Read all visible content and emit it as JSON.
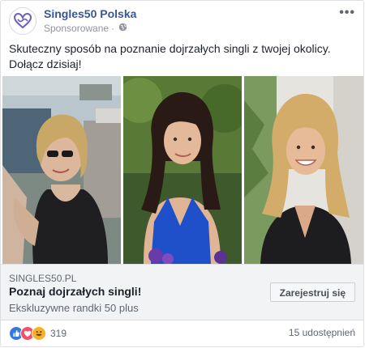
{
  "post": {
    "page_name": "Singles50 Polska",
    "sponsored_label": "Sponsorowane",
    "separator": "·",
    "more_label": "•••",
    "text": "Skuteczny sposób na poznanie dojrzałych singli z twojej okolicy. Dołącz dzisiaj!"
  },
  "link": {
    "domain": "SINGLES50.PL",
    "headline": "Poznaj dojrzałych singli!",
    "description": "Ekskluzywne randki 50 plus",
    "cta_label": "Zarejestruj się"
  },
  "engagement": {
    "reactions_count": "319",
    "shares_label": "15 udostępnień"
  },
  "icons": {
    "logo": "heart-infinity-logo-icon",
    "audience": "globe-icon",
    "reactions": [
      "like-reaction-icon",
      "love-reaction-icon",
      "haha-reaction-icon"
    ]
  },
  "colors": {
    "page_link": "#365899",
    "logo": "#6b5fbf",
    "link_box_bg": "#f2f3f5"
  }
}
